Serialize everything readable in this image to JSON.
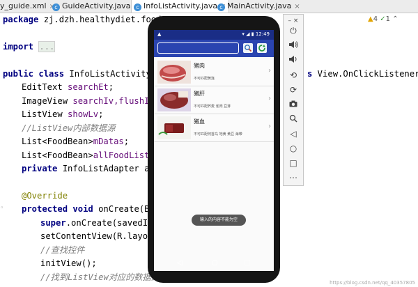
{
  "ide": {
    "tabs": [
      {
        "label": "y_guide.xml",
        "active": false
      },
      {
        "label": "GuideActivity.java",
        "active": false
      },
      {
        "label": "InfoListActivity.java",
        "active": true
      },
      {
        "label": "MainActivity.java",
        "active": false
      }
    ],
    "inspection": {
      "warnings": "4",
      "weak": "1"
    },
    "code": {
      "l1_kw": "package",
      "l1_rest": " zj.dzh.healthydiet.food",
      "l2_kw": "import",
      "l2_fold": "...",
      "l3_kw1": "public",
      "l3_kw2": "class",
      "l3_name": " InfoListActivity e",
      "l3_right_kw": "s",
      "l3_right": " View.OnClickListener{",
      "l4_type": "EditText ",
      "l4_field": "searchEt",
      "l4_end": ";",
      "l5_type": "ImageView ",
      "l5_field": "searchIv,flushIv",
      "l5_end": ";",
      "l6_type": "ListView ",
      "l6_field": "showLv",
      "l6_end": ";",
      "l7_comment": "//ListView内部数据源",
      "l8_type": "List<FoodBean>",
      "l8_field": "mDatas",
      "l8_end": ";",
      "l9_type": "List<FoodBean>",
      "l9_field": "allFoodList",
      "l9_end": ";",
      "l10_kw": "private",
      "l10_rest": " InfoListAdapter adap",
      "l11_anno": "@Override",
      "l12_kw1": "protected",
      "l12_kw2": "void",
      "l12_rest": " onCreate(Bun",
      "l13_kw": "super",
      "l13_rest": ".onCreate(savedInst",
      "l14_rest": "setContentView(R.layout",
      "l15_comment": "//查找控件",
      "l16_rest": "initView();",
      "l17_comment": "//找到ListView对应的数据源"
    },
    "watermark": "https://blog.csdn.net/qq_40357805"
  },
  "phone": {
    "status": {
      "time": "12:49"
    },
    "search": {
      "placeholder": "",
      "value": ""
    },
    "toolbar_icons": [
      "search-icon",
      "refresh-icon"
    ],
    "foods": [
      {
        "name": "猪肉",
        "note": "不可匹配黄连",
        "color": "#c24a4a"
      },
      {
        "name": "猪肝",
        "note": "不可匹配荞麦 雀肉 豆芽",
        "color": "#8a2b2b"
      },
      {
        "name": "猪血",
        "note": "不可匹配何首乌 地黄 黄豆 海带",
        "color": "#7a1c1c"
      }
    ],
    "toast": "输入的内容不能为空",
    "nav": {
      "back": "◁",
      "home": "○",
      "recent": "□"
    }
  },
  "emulator": {
    "close": "×",
    "minimize": "–",
    "buttons": [
      "power-icon",
      "volume-up-icon",
      "volume-down-icon",
      "rotate-left-icon",
      "rotate-right-icon",
      "camera-icon",
      "zoom-icon",
      "back-icon",
      "home-icon",
      "overview-icon",
      "more-icon"
    ],
    "more": "⋯"
  }
}
